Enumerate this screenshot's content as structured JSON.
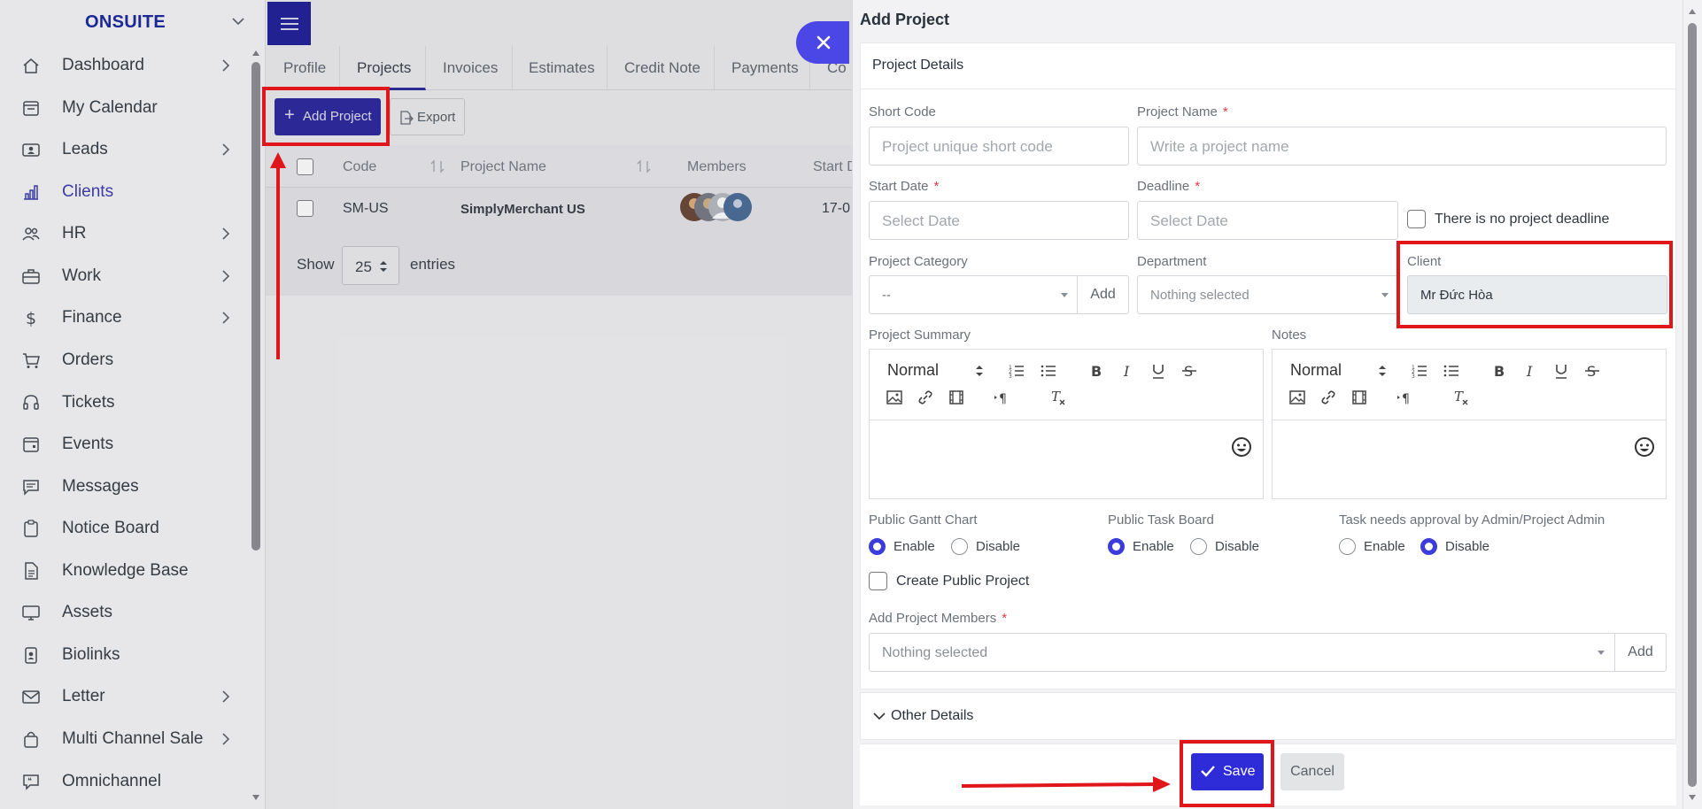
{
  "sidebar": {
    "brand": "ONSUITE",
    "items": [
      {
        "label": "Dashboard",
        "icon": "home-icon",
        "arrow": true
      },
      {
        "label": "My Calendar",
        "icon": "calendar-icon",
        "arrow": false
      },
      {
        "label": "Leads",
        "icon": "id-card-icon",
        "arrow": true
      },
      {
        "label": "Clients",
        "icon": "chart-bars-icon",
        "arrow": false,
        "active": true
      },
      {
        "label": "HR",
        "icon": "people-icon",
        "arrow": true
      },
      {
        "label": "Work",
        "icon": "briefcase-icon",
        "arrow": true
      },
      {
        "label": "Finance",
        "icon": "dollar-icon",
        "arrow": true
      },
      {
        "label": "Orders",
        "icon": "cart-icon",
        "arrow": false
      },
      {
        "label": "Tickets",
        "icon": "headset-icon",
        "arrow": false
      },
      {
        "label": "Events",
        "icon": "calendar-event-icon",
        "arrow": false
      },
      {
        "label": "Messages",
        "icon": "message-icon",
        "arrow": false
      },
      {
        "label": "Notice Board",
        "icon": "clipboard-icon",
        "arrow": false
      },
      {
        "label": "Knowledge Base",
        "icon": "document-icon",
        "arrow": false
      },
      {
        "label": "Assets",
        "icon": "monitor-icon",
        "arrow": false
      },
      {
        "label": "Biolinks",
        "icon": "badge-icon",
        "arrow": false
      },
      {
        "label": "Letter",
        "icon": "envelope-icon",
        "arrow": true
      },
      {
        "label": "Multi Channel Sale",
        "icon": "bag-icon",
        "arrow": true
      },
      {
        "label": "Omnichannel",
        "icon": "chat-quote-icon",
        "arrow": false
      }
    ]
  },
  "tabs": [
    "Profile",
    "Projects",
    "Invoices",
    "Estimates",
    "Credit Note",
    "Payments",
    "Co"
  ],
  "toolbar": {
    "add_project": "Add Project",
    "export": "Export"
  },
  "table": {
    "headers": {
      "code": "Code",
      "project_name": "Project Name",
      "members": "Members",
      "start": "Start D"
    },
    "row": {
      "code": "SM-US",
      "project_name": "SimplyMerchant US",
      "start": "17-0"
    },
    "show": "Show",
    "entries_value": "25",
    "entries": "entries"
  },
  "modal": {
    "title": "Add Project",
    "section_title": "Project Details",
    "short_code": {
      "label": "Short Code",
      "placeholder": "Project unique short code"
    },
    "project_name": {
      "label": "Project Name",
      "placeholder": "Write a project name"
    },
    "start_date": {
      "label": "Start Date",
      "placeholder": "Select Date"
    },
    "deadline": {
      "label": "Deadline",
      "placeholder": "Select Date"
    },
    "no_deadline": "There is no project deadline",
    "category": {
      "label": "Project Category",
      "value": "--",
      "add": "Add"
    },
    "department": {
      "label": "Department",
      "value": "Nothing selected"
    },
    "client": {
      "label": "Client",
      "value": "Mr Đức Hòa"
    },
    "summary": {
      "label": "Project Summary",
      "format": "Normal"
    },
    "notes": {
      "label": "Notes",
      "format": "Normal"
    },
    "gantt": {
      "label": "Public Gantt Chart",
      "enable": "Enable",
      "disable": "Disable"
    },
    "taskboard": {
      "label": "Public Task Board",
      "enable": "Enable",
      "disable": "Disable"
    },
    "approval": {
      "label": "Task needs approval by Admin/Project Admin",
      "enable": "Enable",
      "disable": "Disable"
    },
    "public_project": "Create Public Project",
    "members": {
      "label": "Add Project Members",
      "value": "Nothing selected",
      "add": "Add"
    },
    "other_details": "Other Details",
    "save": "Save",
    "cancel": "Cancel"
  },
  "colors": {
    "primary": "#2e2bd8",
    "sidebar_brand": "#1d2b9f",
    "annotation": "#e0161b"
  }
}
